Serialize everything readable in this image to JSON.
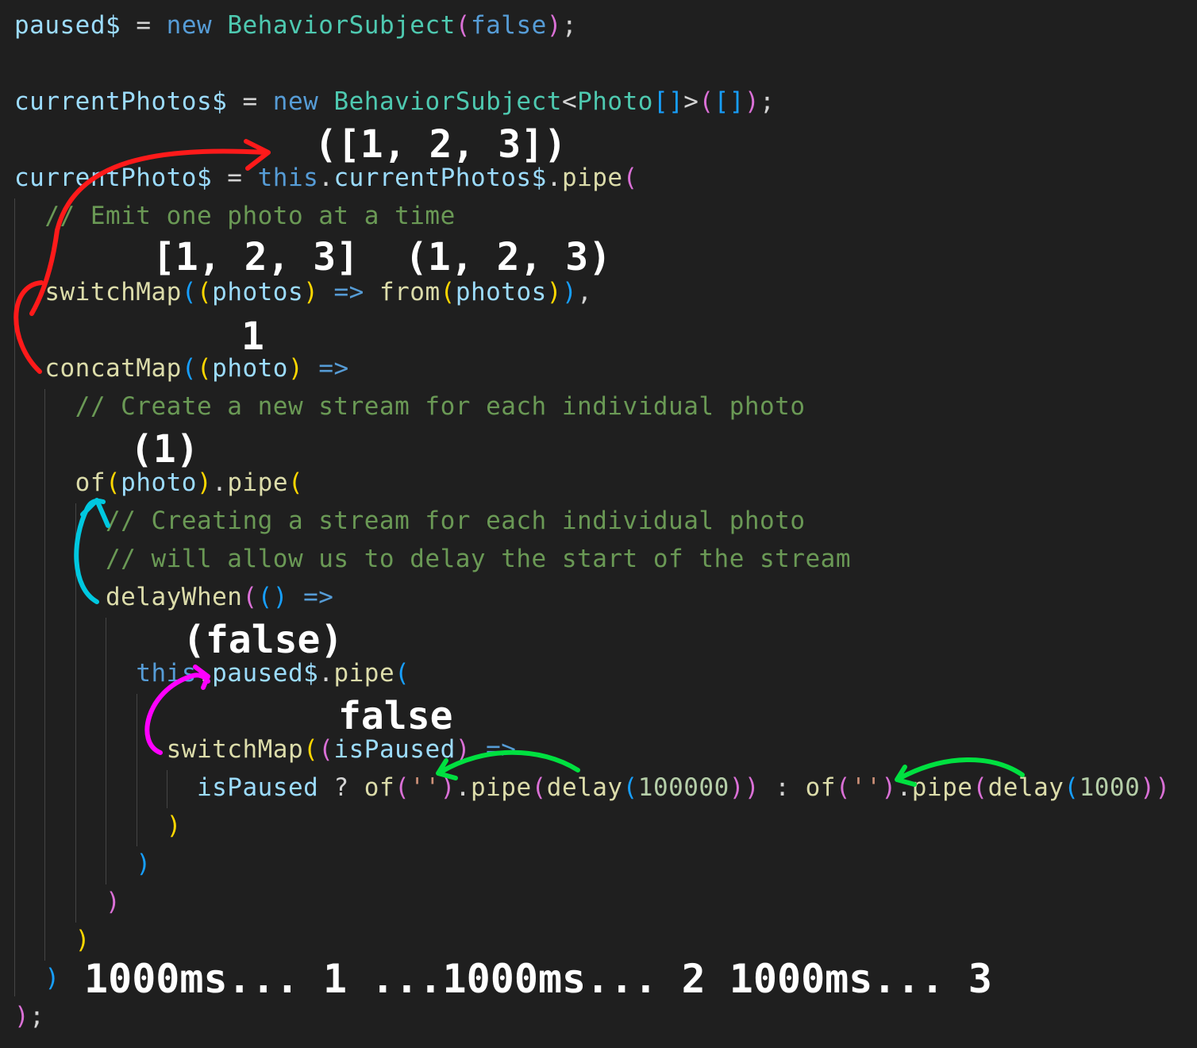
{
  "colors": {
    "background": "#1f1f1f",
    "variable": "#9cdcfe",
    "keyword": "#569cd6",
    "class": "#4ec9b0",
    "function": "#dcdcaa",
    "comment": "#6a9955",
    "plain": "#d4d4d4",
    "number": "#b5cea8",
    "string": "#ce9178",
    "bracket_gold": "#ffd700",
    "bracket_pink": "#da70d6",
    "bracket_blue": "#179fff",
    "annotation": "#ffffff",
    "arrow_red": "#ff1a1a",
    "arrow_cyan": "#00c8e0",
    "arrow_magenta": "#ff00ff",
    "arrow_green": "#00e040"
  },
  "code": [
    {
      "tokens": [
        [
          "paused$",
          "variable"
        ],
        [
          " = ",
          "plain"
        ],
        [
          "new",
          "keyword"
        ],
        [
          " ",
          "plain"
        ],
        [
          "BehaviorSubject",
          "class"
        ],
        [
          "(",
          "bracket_pink"
        ],
        [
          "false",
          "keyword"
        ],
        [
          ")",
          "bracket_pink"
        ],
        [
          ";",
          "plain"
        ]
      ]
    },
    {
      "tokens": []
    },
    {
      "tokens": [
        [
          "currentPhotos$",
          "variable"
        ],
        [
          " = ",
          "plain"
        ],
        [
          "new",
          "keyword"
        ],
        [
          " ",
          "plain"
        ],
        [
          "BehaviorSubject",
          "class"
        ],
        [
          "<",
          "plain"
        ],
        [
          "Photo",
          "class"
        ],
        [
          "[]",
          "bracket_blue"
        ],
        [
          ">",
          "plain"
        ],
        [
          "(",
          "bracket_pink"
        ],
        [
          "[]",
          "bracket_blue"
        ],
        [
          ")",
          "bracket_pink"
        ],
        [
          ";",
          "plain"
        ]
      ]
    },
    {
      "tokens": []
    },
    {
      "tokens": [
        [
          "currentPhoto$",
          "variable"
        ],
        [
          " = ",
          "plain"
        ],
        [
          "this",
          "keyword"
        ],
        [
          ".",
          "plain"
        ],
        [
          "currentPhotos$",
          "variable"
        ],
        [
          ".",
          "plain"
        ],
        [
          "pipe",
          "function"
        ],
        [
          "(",
          "bracket_pink"
        ]
      ]
    },
    {
      "tokens": [
        [
          "  // Emit one photo at a time",
          "comment"
        ]
      ]
    },
    {
      "tokens": []
    },
    {
      "tokens": [
        [
          "  ",
          "plain"
        ],
        [
          "switchMap",
          "function"
        ],
        [
          "(",
          "bracket_blue"
        ],
        [
          "(",
          "bracket_gold"
        ],
        [
          "photos",
          "variable"
        ],
        [
          ")",
          "bracket_gold"
        ],
        [
          " ",
          "plain"
        ],
        [
          "=>",
          "keyword"
        ],
        [
          " ",
          "plain"
        ],
        [
          "from",
          "function"
        ],
        [
          "(",
          "bracket_gold"
        ],
        [
          "photos",
          "variable"
        ],
        [
          ")",
          "bracket_gold"
        ],
        [
          ")",
          "bracket_blue"
        ],
        [
          ",",
          "plain"
        ]
      ]
    },
    {
      "tokens": []
    },
    {
      "tokens": [
        [
          "  ",
          "plain"
        ],
        [
          "concatMap",
          "function"
        ],
        [
          "(",
          "bracket_blue"
        ],
        [
          "(",
          "bracket_gold"
        ],
        [
          "photo",
          "variable"
        ],
        [
          ")",
          "bracket_gold"
        ],
        [
          " ",
          "plain"
        ],
        [
          "=>",
          "keyword"
        ]
      ]
    },
    {
      "tokens": [
        [
          "    // Create a new stream for each individual photo",
          "comment"
        ]
      ]
    },
    {
      "tokens": []
    },
    {
      "tokens": [
        [
          "    ",
          "plain"
        ],
        [
          "of",
          "function"
        ],
        [
          "(",
          "bracket_gold"
        ],
        [
          "photo",
          "variable"
        ],
        [
          ")",
          "bracket_gold"
        ],
        [
          ".",
          "plain"
        ],
        [
          "pipe",
          "function"
        ],
        [
          "(",
          "bracket_gold"
        ]
      ]
    },
    {
      "tokens": [
        [
          "      // Creating a stream for each individual photo",
          "comment"
        ]
      ]
    },
    {
      "tokens": [
        [
          "      // will allow us to delay the start of the stream",
          "comment"
        ]
      ]
    },
    {
      "tokens": [
        [
          "      ",
          "plain"
        ],
        [
          "delayWhen",
          "function"
        ],
        [
          "(",
          "bracket_pink"
        ],
        [
          "()",
          "bracket_blue"
        ],
        [
          " ",
          "plain"
        ],
        [
          "=>",
          "keyword"
        ]
      ]
    },
    {
      "tokens": []
    },
    {
      "tokens": [
        [
          "        ",
          "plain"
        ],
        [
          "this",
          "keyword"
        ],
        [
          ".",
          "plain"
        ],
        [
          "paused$",
          "variable"
        ],
        [
          ".",
          "plain"
        ],
        [
          "pipe",
          "function"
        ],
        [
          "(",
          "bracket_blue"
        ]
      ]
    },
    {
      "tokens": []
    },
    {
      "tokens": [
        [
          "          ",
          "plain"
        ],
        [
          "switchMap",
          "function"
        ],
        [
          "(",
          "bracket_gold"
        ],
        [
          "(",
          "bracket_pink"
        ],
        [
          "isPaused",
          "variable"
        ],
        [
          ")",
          "bracket_pink"
        ],
        [
          " ",
          "plain"
        ],
        [
          "=>",
          "keyword"
        ]
      ]
    },
    {
      "tokens": [
        [
          "            ",
          "plain"
        ],
        [
          "isPaused",
          "variable"
        ],
        [
          " ? ",
          "plain"
        ],
        [
          "of",
          "function"
        ],
        [
          "(",
          "bracket_pink"
        ],
        [
          "''",
          "string"
        ],
        [
          ")",
          "bracket_pink"
        ],
        [
          ".",
          "plain"
        ],
        [
          "pipe",
          "function"
        ],
        [
          "(",
          "bracket_pink"
        ],
        [
          "delay",
          "function"
        ],
        [
          "(",
          "bracket_blue"
        ],
        [
          "100000",
          "number"
        ],
        [
          "))",
          "bracket_pink"
        ],
        [
          " : ",
          "plain"
        ],
        [
          "of",
          "function"
        ],
        [
          "(",
          "bracket_pink"
        ],
        [
          "''",
          "string"
        ],
        [
          ")",
          "bracket_pink"
        ],
        [
          ".",
          "plain"
        ],
        [
          "pipe",
          "function"
        ],
        [
          "(",
          "bracket_pink"
        ],
        [
          "delay",
          "function"
        ],
        [
          "(",
          "bracket_blue"
        ],
        [
          "1000",
          "number"
        ],
        [
          "))",
          "bracket_pink"
        ]
      ]
    },
    {
      "tokens": [
        [
          "          ",
          "plain"
        ],
        [
          ")",
          "bracket_gold"
        ]
      ]
    },
    {
      "tokens": [
        [
          "        ",
          "plain"
        ],
        [
          ")",
          "bracket_blue"
        ]
      ]
    },
    {
      "tokens": [
        [
          "      ",
          "plain"
        ],
        [
          ")",
          "bracket_pink"
        ]
      ]
    },
    {
      "tokens": [
        [
          "    ",
          "plain"
        ],
        [
          ")",
          "bracket_gold"
        ]
      ]
    },
    {
      "tokens": [
        [
          "  ",
          "plain"
        ],
        [
          ")",
          "bracket_blue"
        ]
      ]
    },
    {
      "tokens": [
        [
          ")",
          "bracket_pink"
        ],
        [
          ";",
          "plain"
        ]
      ]
    }
  ],
  "annotations": {
    "pipe_input": "([1, 2, 3])",
    "switchmap_input": "[1, 2, 3]",
    "from_output": "(1, 2, 3)",
    "concatmap_input": "1",
    "of_input": "(1)",
    "paused_value": "(false)",
    "ispaused_value": "false",
    "timeline": "1000ms... 1 ...1000ms... 2 1000ms... 3"
  }
}
